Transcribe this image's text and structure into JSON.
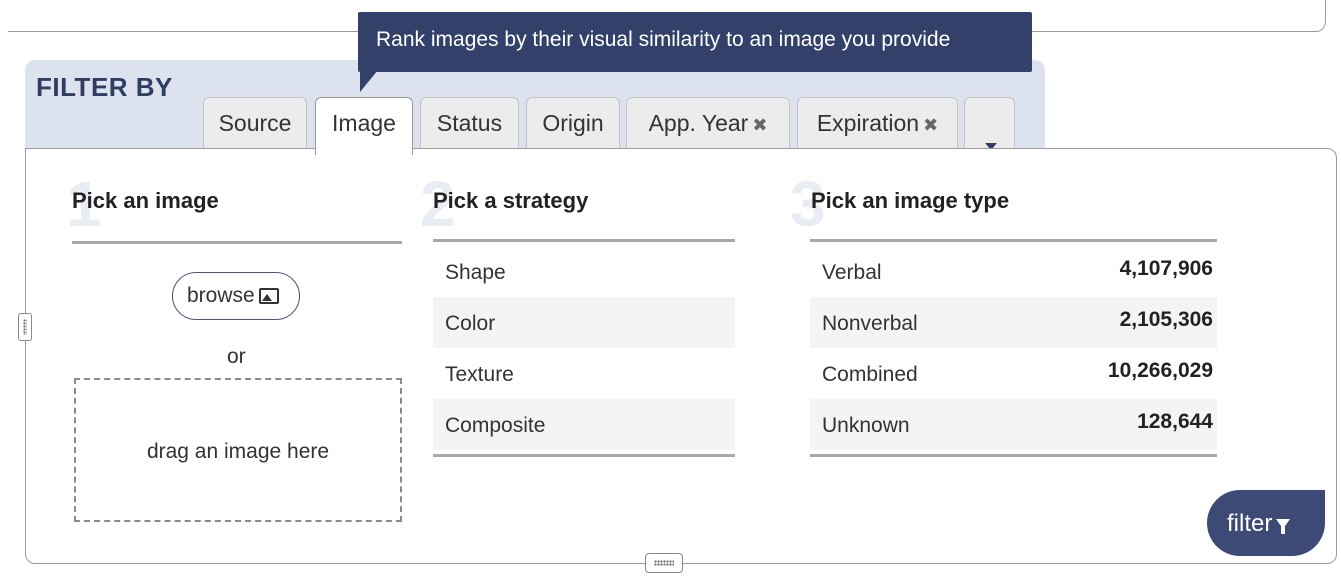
{
  "tooltip": {
    "text": "Rank images by their visual similarity to an image you provide"
  },
  "filter_header": {
    "title": "FILTER BY"
  },
  "tabs": [
    {
      "label": "Source",
      "removable": false,
      "active": false
    },
    {
      "label": "Image",
      "removable": false,
      "active": true
    },
    {
      "label": "Status",
      "removable": false,
      "active": false
    },
    {
      "label": "Origin",
      "removable": false,
      "active": false
    },
    {
      "label": "App. Year",
      "removable": true,
      "active": false
    },
    {
      "label": "Expiration",
      "removable": true,
      "active": false
    }
  ],
  "remove_glyph": "✖",
  "steps": [
    {
      "number": "1",
      "heading": "Pick an image"
    },
    {
      "number": "2",
      "heading": "Pick a strategy"
    },
    {
      "number": "3",
      "heading": "Pick an image type"
    }
  ],
  "pick_image": {
    "browse_label": "browse",
    "browse_icon": "image-icon",
    "or_text": "or",
    "dropzone_text": "drag an image here"
  },
  "strategies": [
    "Shape",
    "Color",
    "Texture",
    "Composite"
  ],
  "image_types": [
    {
      "label": "Verbal",
      "count": "4,107,906"
    },
    {
      "label": "Nonverbal",
      "count": "2,105,306"
    },
    {
      "label": "Combined",
      "count": "10,266,029"
    },
    {
      "label": "Unknown",
      "count": "128,644"
    }
  ],
  "filter_button": {
    "label": "filter",
    "icon": "funnel-icon"
  },
  "colors": {
    "accent": "#33406a",
    "band": "#dde3ee",
    "title": "#2f3d63"
  }
}
